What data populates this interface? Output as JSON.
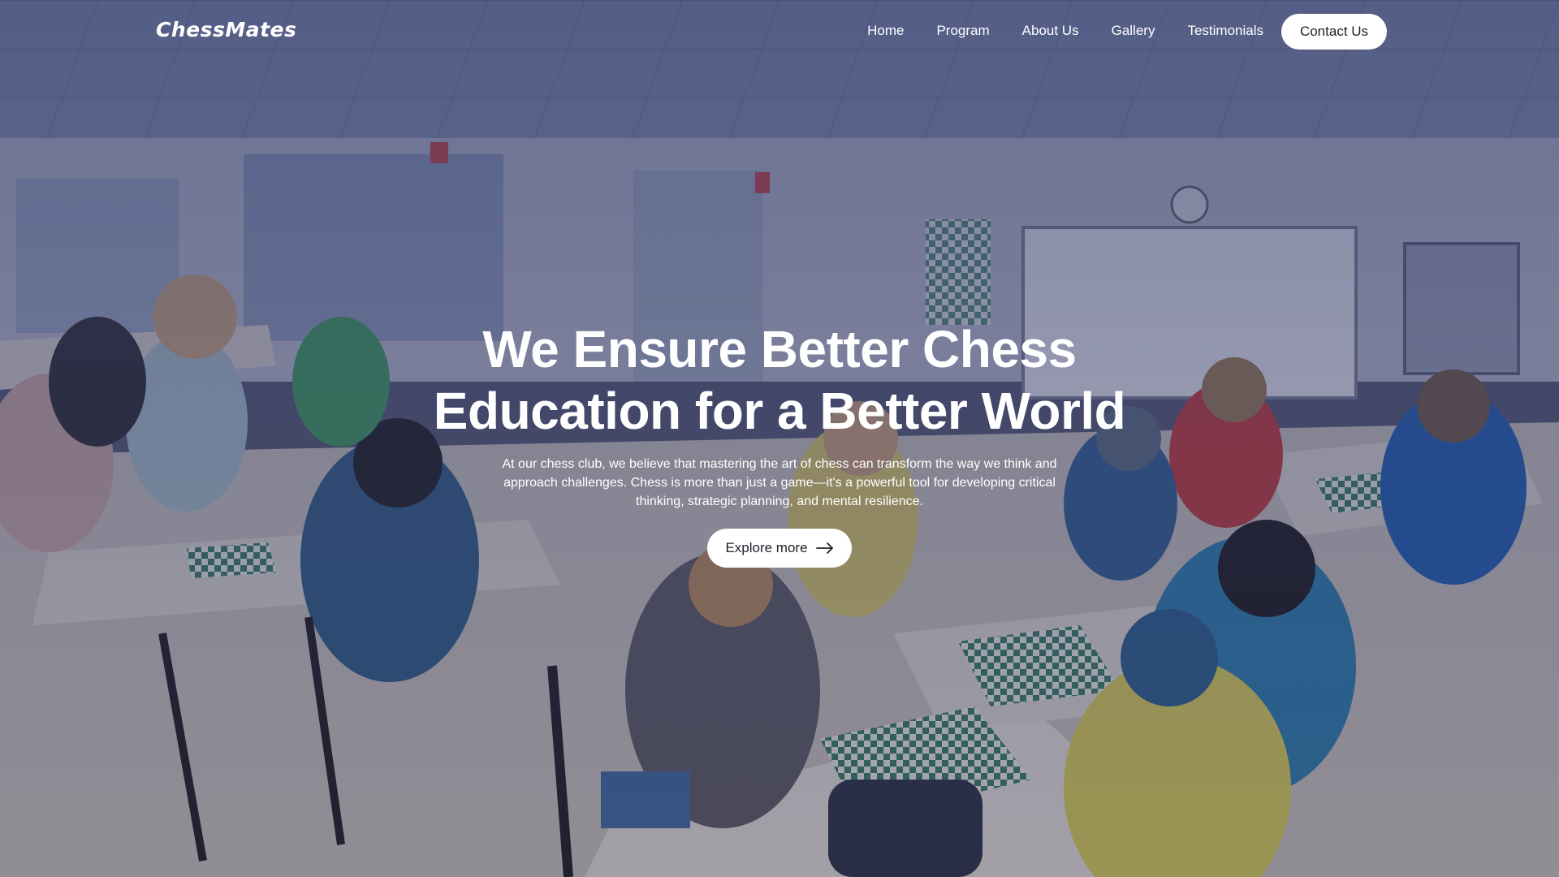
{
  "brand": {
    "logo": "ChessMates"
  },
  "nav": {
    "links": [
      {
        "label": "Home"
      },
      {
        "label": "Program"
      },
      {
        "label": "About Us"
      },
      {
        "label": "Gallery"
      },
      {
        "label": "Testimonials"
      }
    ],
    "cta_label": "Contact Us"
  },
  "hero": {
    "title_line1": "We Ensure Better Chess",
    "title_line2": "Education for a Better World",
    "description": "At our chess club, we believe that mastering the art of chess can transform the way we think and approach challenges. Chess is more than just a game—it's a powerful tool for developing critical thinking, strategic planning, and mental resilience.",
    "cta_label": "Explore more",
    "cta_icon": "arrow-right-icon",
    "background": "chess tournament classroom photo"
  },
  "colors": {
    "overlay": "#2f3a6e",
    "text": "#ffffff",
    "button_bg": "#ffffff",
    "button_text": "#1e1e28"
  }
}
